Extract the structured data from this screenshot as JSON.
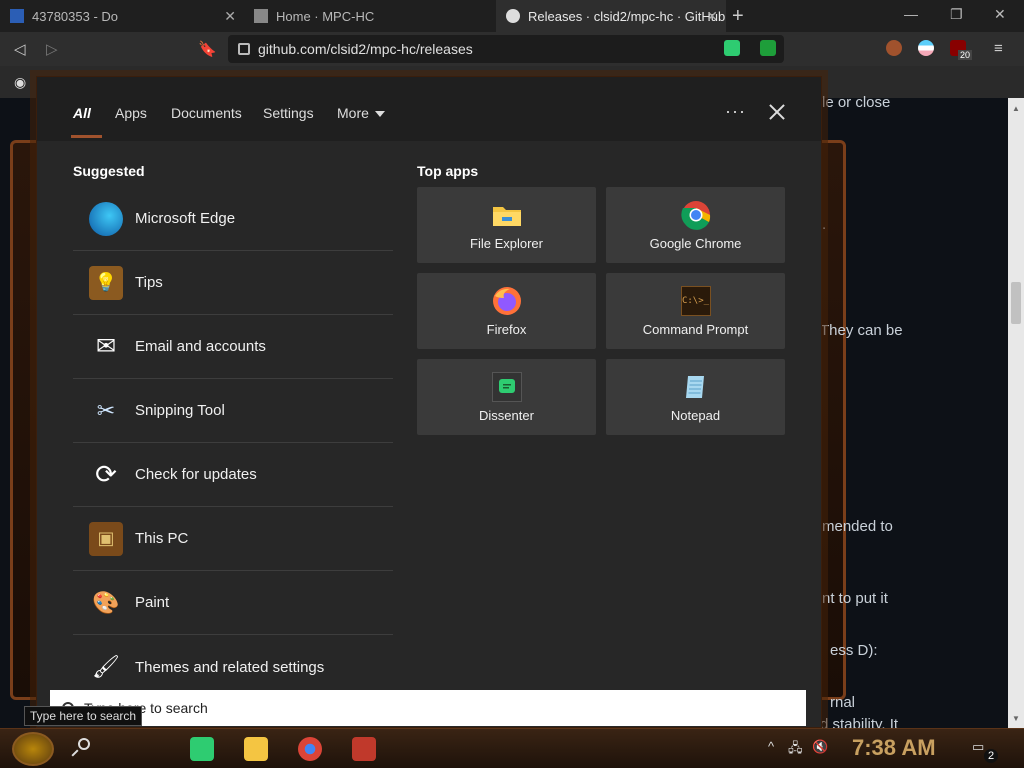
{
  "browser": {
    "tabs": [
      {
        "title": "43780353 - Do"
      },
      {
        "title": "Home · MPC-HC"
      },
      {
        "title": "Releases · clsid2/mpc-hc · GitHub"
      }
    ],
    "address": "github.com/clsid2/mpc-hc/releases",
    "profile_badge": "20"
  },
  "page_fragments": [
    "le or close",
    ".",
    "They can be",
    "mended to",
    "nt to put it",
    "ess D):",
    "rnal",
    "d stability. It"
  ],
  "search_panel": {
    "tabs": {
      "all": "All",
      "apps": "Apps",
      "documents": "Documents",
      "settings": "Settings",
      "more": "More"
    },
    "suggested_title": "Suggested",
    "suggested": [
      {
        "label": "Microsoft Edge",
        "icon": "edge-icon"
      },
      {
        "label": "Tips",
        "icon": "lightbulb-icon"
      },
      {
        "label": "Email and accounts",
        "icon": "mail-icon"
      },
      {
        "label": "Snipping Tool",
        "icon": "scissors-icon"
      },
      {
        "label": "Check for updates",
        "icon": "sync-icon"
      },
      {
        "label": "This PC",
        "icon": "computer-icon"
      },
      {
        "label": "Paint",
        "icon": "palette-icon"
      },
      {
        "label": "Themes and related settings",
        "icon": "brush-monitor-icon"
      }
    ],
    "top_apps_title": "Top apps",
    "top_apps": [
      {
        "label": "File Explorer",
        "icon": "folder-icon"
      },
      {
        "label": "Google Chrome",
        "icon": "chrome-icon"
      },
      {
        "label": "Firefox",
        "icon": "firefox-icon"
      },
      {
        "label": "Command Prompt",
        "icon": "terminal-icon"
      },
      {
        "label": "Dissenter",
        "icon": "dissenter-icon"
      },
      {
        "label": "Notepad",
        "icon": "notepad-icon"
      }
    ],
    "search_box_text": "Type here to search",
    "tooltip": "Type here to search"
  },
  "taskbar": {
    "clock": "7:38 AM",
    "notifications": "2"
  },
  "colors": {
    "panel_bg": "#272727",
    "header_bg": "#1f1f1f",
    "tile_bg": "#3a3a3a",
    "accent": "#a0522d"
  }
}
